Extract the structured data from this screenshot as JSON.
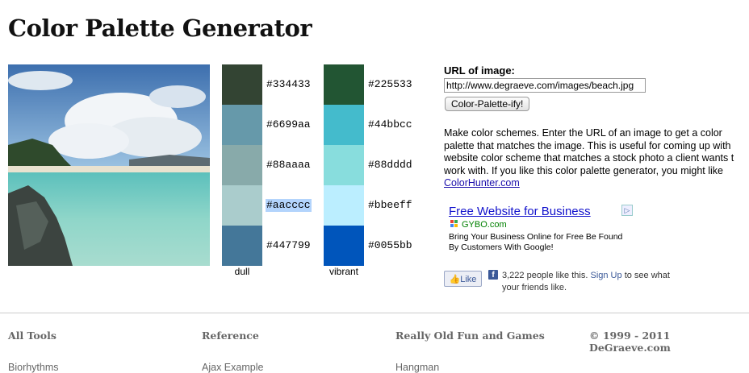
{
  "page": {
    "title": "Color Palette Generator"
  },
  "palettes": {
    "dull": {
      "label": "dull",
      "colors": [
        "#334433",
        "#6699aa",
        "#88aaaa",
        "#aacccc",
        "#447799"
      ]
    },
    "vibrant": {
      "label": "vibrant",
      "colors": [
        "#225533",
        "#44bbcc",
        "#88dddd",
        "#bbeeff",
        "#0055bb"
      ]
    }
  },
  "form": {
    "url_label": "URL of image:",
    "url_value": "http://www.degraeve.com/images/beach.jpg",
    "submit_label": "Color-Palette-ify!"
  },
  "description": {
    "lines": [
      "Make color schemes. Enter the URL of an image to get a color",
      "palette that matches the image. This is useful for coming up with",
      "website color scheme that matches a stock photo a client wants t",
      "work with. If you like this color palette generator, you might like"
    ],
    "link": "ColorHunter.com"
  },
  "ad": {
    "title": "Free Website for Business",
    "domain": "GYBO.com",
    "body_line1": "Bring Your Business Online for Free Be Found",
    "body_line2": "By Customers With Google!"
  },
  "facebook": {
    "like_label": "Like",
    "count_text": "3,222 people like this.",
    "signup_link": "Sign Up",
    "after_text": "to see what",
    "line2": "your friends like."
  },
  "footer": {
    "columns": [
      {
        "heading": "All Tools",
        "link": "Biorhythms"
      },
      {
        "heading": "Reference",
        "link": "Ajax Example"
      },
      {
        "heading": "Really Old Fun and Games",
        "link": "Hangman"
      }
    ],
    "copyright": "© 1999 - 2011 DeGraeve.com"
  },
  "colors": {
    "link": "#1a0dab",
    "ad_link": "#1111cc",
    "facebook": "#3b5998"
  }
}
